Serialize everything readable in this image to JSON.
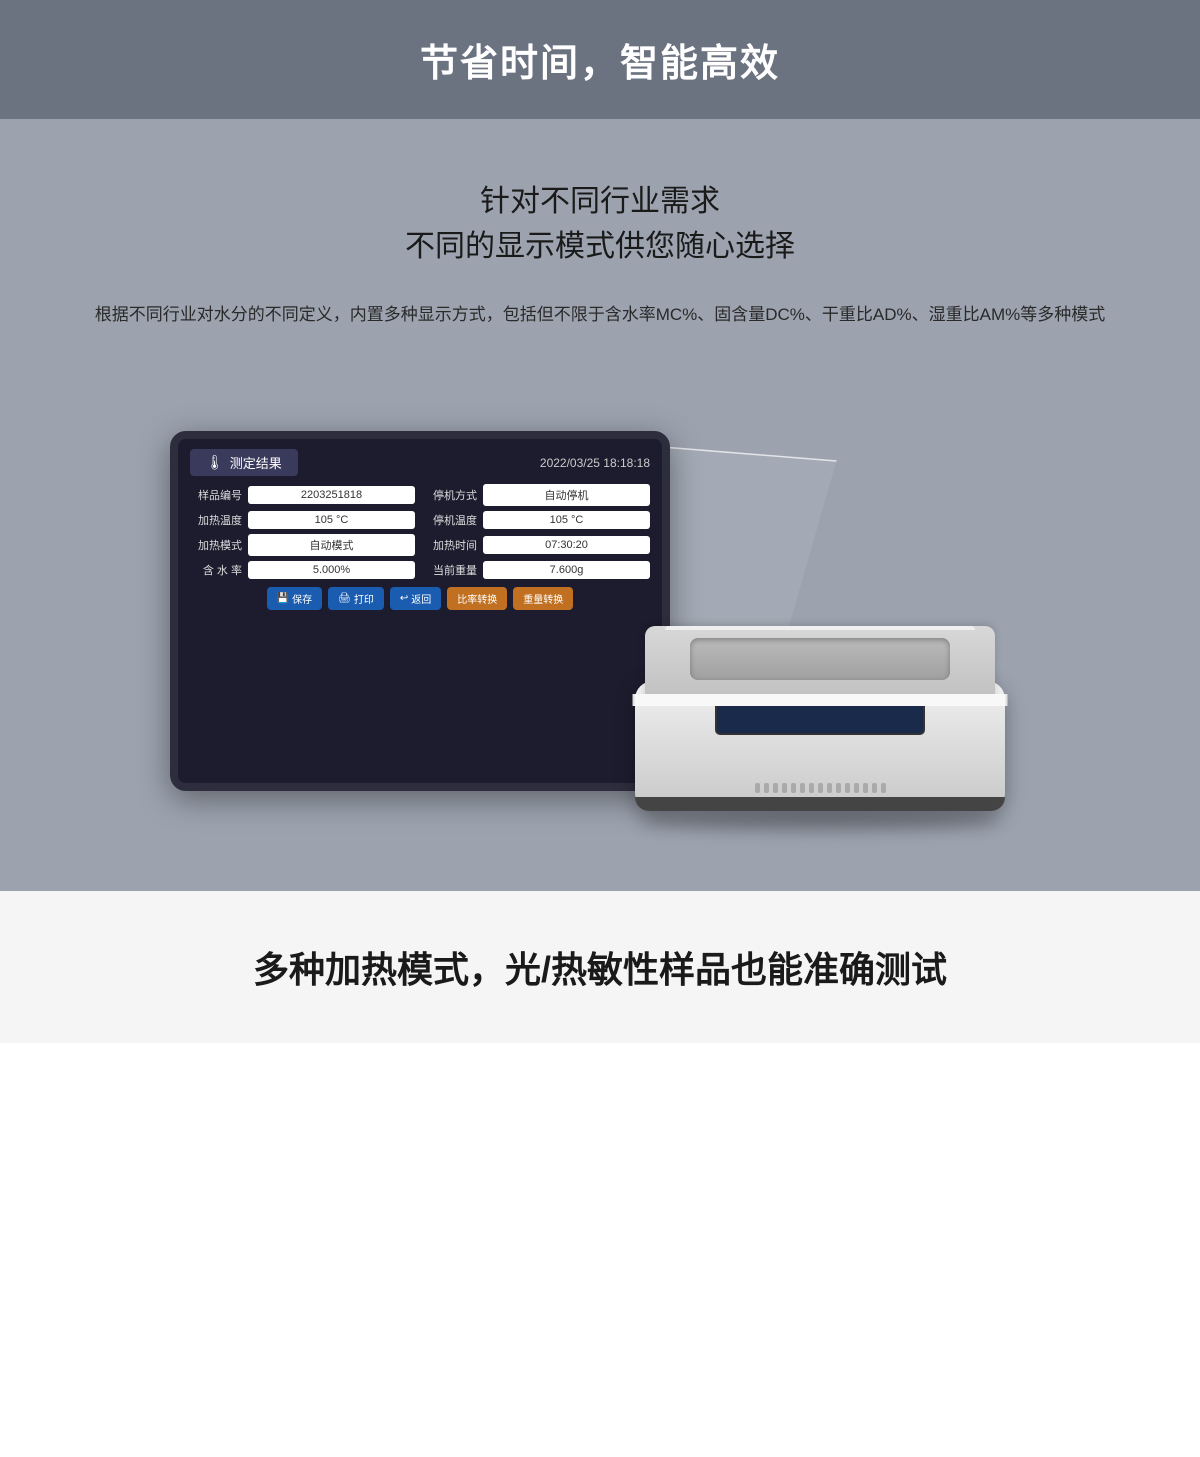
{
  "header": {
    "title": "节省时间，智能高效"
  },
  "main": {
    "subtitle_line1": "针对不同行业需求",
    "subtitle_line2": "不同的显示模式供您随心选择",
    "desc": "根据不同行业对水分的不同定义，内置多种显示方式，包括但不限于含水率MC%、固含量DC%、干重比AD%、湿重比AM%等多种模式"
  },
  "screen": {
    "title": "测定结果",
    "datetime": "2022/03/25    18:18:18",
    "fields": [
      {
        "label": "样品编号",
        "value": "2203251818",
        "col": 1
      },
      {
        "label": "停机方式",
        "value": "自动停机",
        "col": 2
      },
      {
        "label": "加热温度",
        "value": "105 °C",
        "col": 1
      },
      {
        "label": "停机温度",
        "value": "105 °C",
        "col": 2
      },
      {
        "label": "加热模式",
        "value": "自动模式",
        "col": 1
      },
      {
        "label": "加热时间",
        "value": "07:30:20",
        "col": 2
      },
      {
        "label": "含  水  率",
        "value": "5.000%",
        "col": 1
      },
      {
        "label": "当前重量",
        "value": "7.600g",
        "col": 2
      }
    ],
    "buttons": [
      {
        "label": "保存",
        "icon": "💾",
        "type": "blue"
      },
      {
        "label": "打印",
        "icon": "🖨",
        "type": "blue"
      },
      {
        "label": "返回",
        "icon": "↩",
        "type": "blue"
      },
      {
        "label": "比率转换",
        "icon": "",
        "type": "orange"
      },
      {
        "label": "重量转换",
        "icon": "",
        "type": "orange"
      }
    ]
  },
  "bottom": {
    "title": "多种加热模式，光/热敏性样品也能准确测试"
  }
}
